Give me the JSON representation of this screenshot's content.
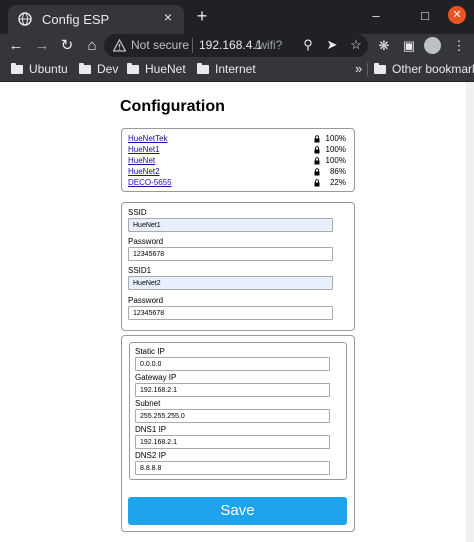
{
  "browser": {
    "tab_title": "Config ESP",
    "tab_close_glyph": "×",
    "new_tab_glyph": "+",
    "security_label": "Not secure",
    "url_host": "192.168.4.1",
    "url_path": "/wifi?",
    "bookmarks": [
      "Ubuntu",
      "Dev",
      "HueNet",
      "Internet"
    ],
    "other_bookmarks": "Other bookmarks",
    "icons": [
      "globe-icon",
      "close-icon",
      "plus-icon",
      "minimize-icon",
      "maximize-icon",
      "window-close-icon",
      "back-arrow-icon",
      "forward-arrow-icon",
      "reload-icon",
      "home-icon",
      "warning-icon",
      "zoom-icon",
      "send-icon",
      "star-icon",
      "extensions-icon",
      "media-icon",
      "avatar-icon",
      "menu-icon",
      "folder-icon",
      "chevron-double-right-icon"
    ]
  },
  "page": {
    "title": "Configuration",
    "networks": [
      {
        "ssid": "HueNetTek",
        "quality": "100%"
      },
      {
        "ssid": "HueNet1",
        "quality": "100%"
      },
      {
        "ssid": "HueNet",
        "quality": "100%"
      },
      {
        "ssid": "HueNet2",
        "quality": "86%"
      },
      {
        "ssid": "DECO-5655",
        "quality": "22%"
      }
    ],
    "wifi": {
      "ssid_label": "SSID",
      "ssid_value": "HueNet1",
      "password_label": "Password",
      "password_value": "12345678",
      "ssid1_label": "SSID1",
      "ssid1_value": "HueNet2",
      "password1_label": "Password",
      "password1_value": "12345678"
    },
    "ip": {
      "static_ip_label": "Static IP",
      "static_ip_value": "0.0.0.0",
      "gateway_label": "Gateway IP",
      "gateway_value": "192.168.2.1",
      "subnet_label": "Subnet",
      "subnet_value": "255.255.255.0",
      "dns1_label": "DNS1 IP",
      "dns1_value": "192.168.2.1",
      "dns2_label": "DNS2 IP",
      "dns2_value": "8.8.8.8"
    },
    "save_label": "Save",
    "colors": {
      "save_button": "#1fa3ec",
      "link": "#1a0dab",
      "autofill": "#e8f0fe"
    }
  }
}
